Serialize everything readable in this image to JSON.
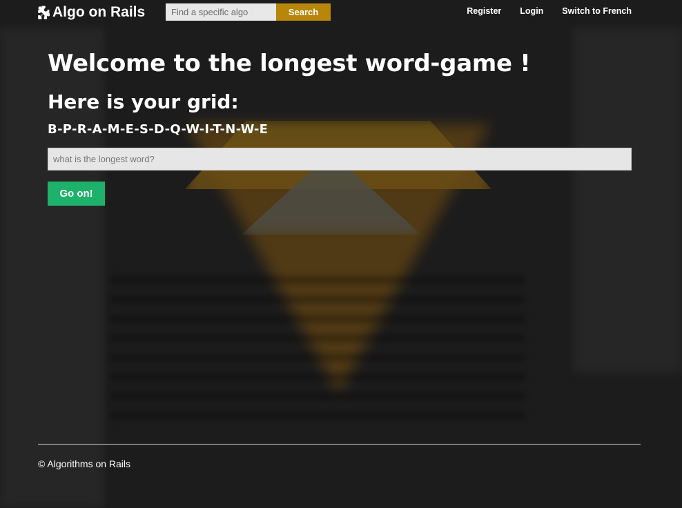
{
  "navbar": {
    "brand": "Algo on Rails",
    "brand_icon": "puzzle-piece-icon",
    "search": {
      "placeholder": "Find a specific algo",
      "value": "",
      "button_label": "Search"
    },
    "links": {
      "register": "Register",
      "login": "Login",
      "switch_language": "Switch to French"
    }
  },
  "main": {
    "title": "Welcome to the longest word-game !",
    "subtitle": "Here is your grid:",
    "grid": "B-P-R-A-M-E-S-D-Q-W-I-T-N-W-E",
    "answer_input": {
      "placeholder": "what is the longest word?",
      "value": ""
    },
    "submit_label": "Go on!"
  },
  "footer": {
    "text": "© Algorithms on Rails"
  },
  "colors": {
    "background": "#1c1c1c",
    "search_button": "#b8860b",
    "go_button": "#1db16b"
  }
}
